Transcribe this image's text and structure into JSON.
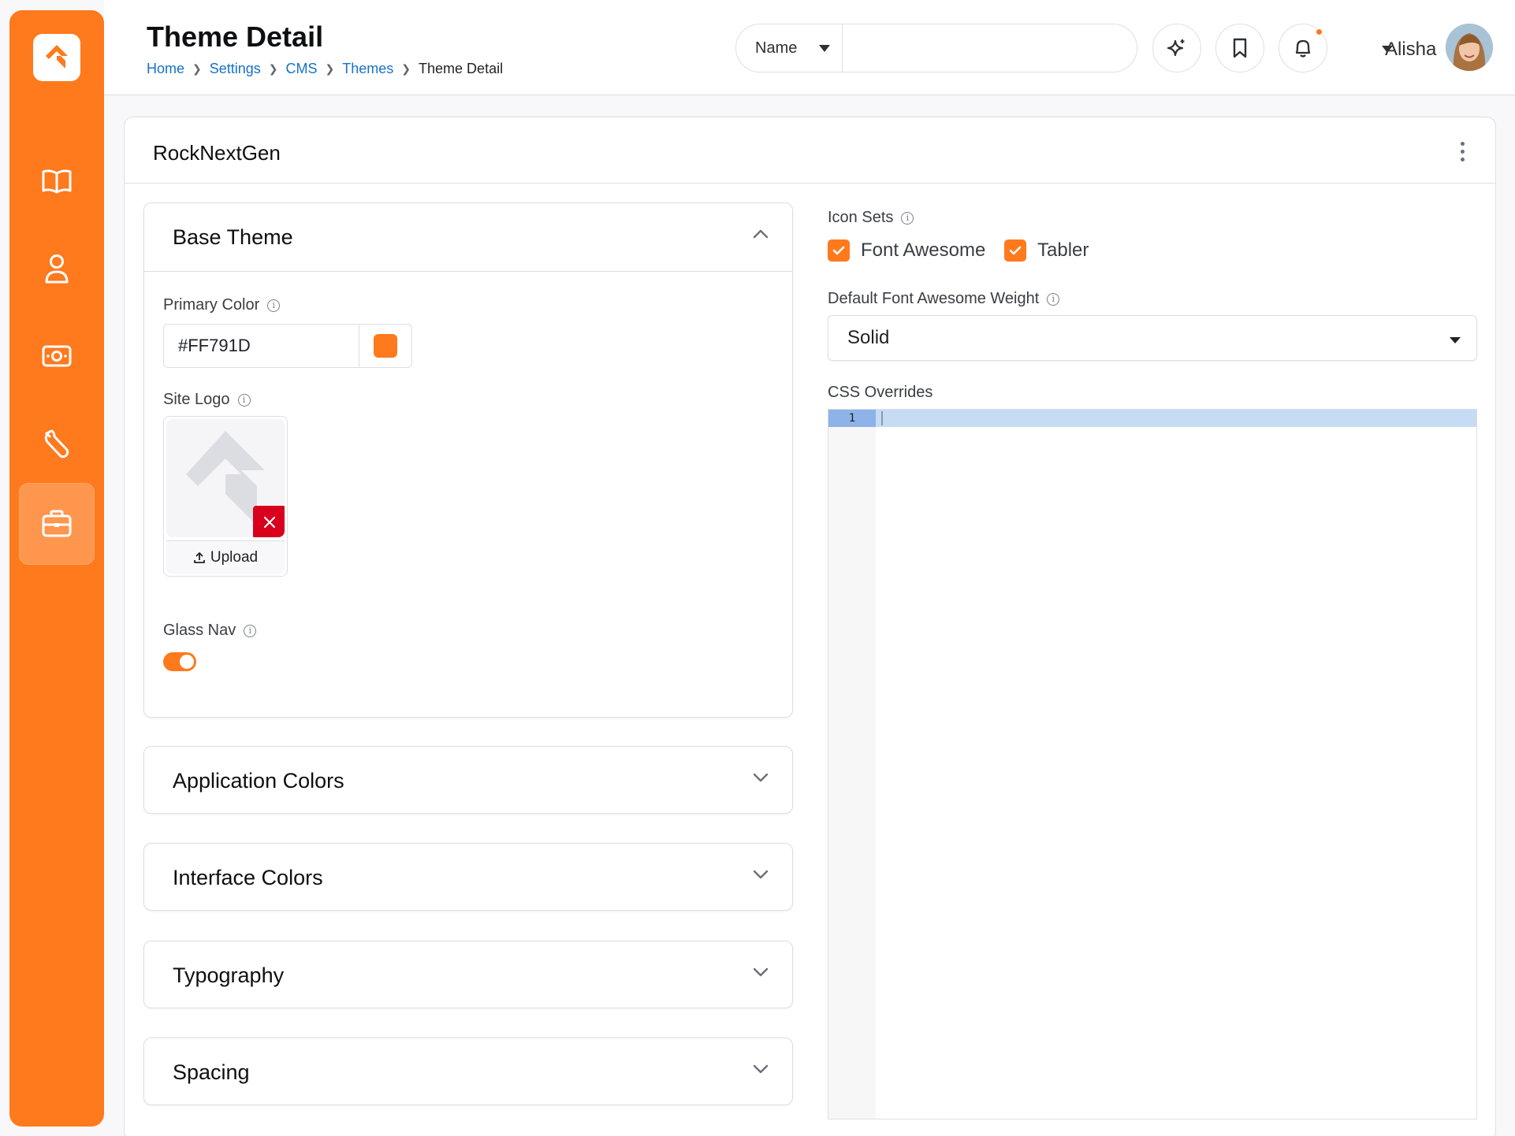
{
  "header": {
    "title": "Theme Detail",
    "breadcrumb": [
      "Home",
      "Settings",
      "CMS",
      "Themes",
      "Theme Detail"
    ],
    "search": {
      "type_label": "Name",
      "value": ""
    },
    "user": {
      "name": "Alisha"
    }
  },
  "sidebar": {
    "items": [
      {
        "icon": "book-icon"
      },
      {
        "icon": "user-icon"
      },
      {
        "icon": "cash-icon"
      },
      {
        "icon": "wrench-icon"
      },
      {
        "icon": "briefcase-icon",
        "active": true
      }
    ]
  },
  "card": {
    "title": "RockNextGen"
  },
  "base_theme": {
    "title": "Base Theme",
    "primary_color_label": "Primary Color",
    "primary_color_value": "#FF791D",
    "site_logo_label": "Site Logo",
    "upload_label": "Upload",
    "glass_nav_label": "Glass Nav",
    "glass_nav_on": true
  },
  "collapsed_panels": [
    {
      "title": "Application Colors"
    },
    {
      "title": "Interface Colors"
    },
    {
      "title": "Typography"
    },
    {
      "title": "Spacing"
    }
  ],
  "right": {
    "icon_sets_label": "Icon Sets",
    "icon_sets": [
      {
        "label": "Font Awesome",
        "checked": true
      },
      {
        "label": "Tabler",
        "checked": true
      }
    ],
    "fa_weight_label": "Default Font Awesome Weight",
    "fa_weight_value": "Solid",
    "css_overrides_label": "CSS Overrides",
    "css_line_number": "1"
  },
  "colors": {
    "accent": "#ff791d",
    "link": "#1672c7",
    "danger": "#d8001c"
  }
}
